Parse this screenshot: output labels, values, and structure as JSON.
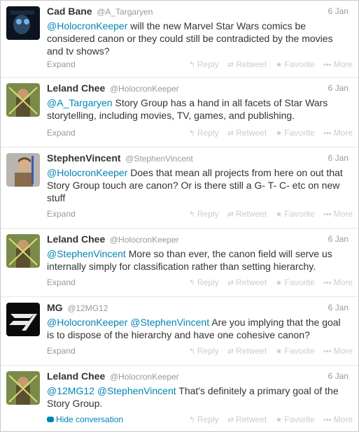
{
  "actions": {
    "reply": "Reply",
    "retweet": "Retweet",
    "favorite": "Favorite",
    "more": "More",
    "reply_icon": "reply-arrow-icon",
    "retweet_icon": "retweet-icon",
    "favorite_icon": "star-icon",
    "more_icon": "ellipsis-icon"
  },
  "colors": {
    "link": "#0084b4",
    "name": "#333333",
    "meta": "#999999",
    "action": "#cccccc",
    "highlight": "#f5f5f5"
  },
  "tweets": [
    {
      "name": "Cad Bane",
      "handle": "@A_Targaryen",
      "date": "6 Jan",
      "mention": "@HolocronKeeper",
      "text": " will the new Marvel Star Wars comics be considered canon or they could still be contradicted by the movies and tv shows?",
      "footer": "Expand"
    },
    {
      "name": "Leland Chee",
      "handle": "@HolocronKeeper",
      "date": "6 Jan",
      "mention": "@A_Targaryen",
      "text": " Story Group has a hand in all facets of Star Wars storytelling, including movies, TV, games, and publishing.",
      "footer": "Expand"
    },
    {
      "name": "StephenVincent",
      "handle": "@StephenVincent",
      "date": "6 Jan",
      "mention": "@HolocronKeeper",
      "text": " Does that mean all projects from here on out that Story Group touch are canon? Or is there still a G- T- C- etc on new stuff",
      "footer": "Expand"
    },
    {
      "name": "Leland Chee",
      "handle": "@HolocronKeeper",
      "date": "6 Jan",
      "mention": "@StephenVincent",
      "text": " More so than ever, the canon field will serve us internally simply for classification rather than setting hierarchy.",
      "footer": "Expand"
    },
    {
      "name": "MG",
      "handle": "@12MG12",
      "date": "6 Jan",
      "mention": "@HolocronKeeper",
      "mention2": "@StephenVincent",
      "text": " Are you implying that the goal is to dispose of the hierarchy and have one cohesive canon?",
      "footer": "Expand"
    },
    {
      "name": "Leland Chee",
      "handle": "@HolocronKeeper",
      "date": "6 Jan",
      "mention": "@12MG12",
      "mention2": "@StephenVincent",
      "text": " That's definitely a primary goal of the Story Group.",
      "footer": "Hide conversation"
    }
  ]
}
